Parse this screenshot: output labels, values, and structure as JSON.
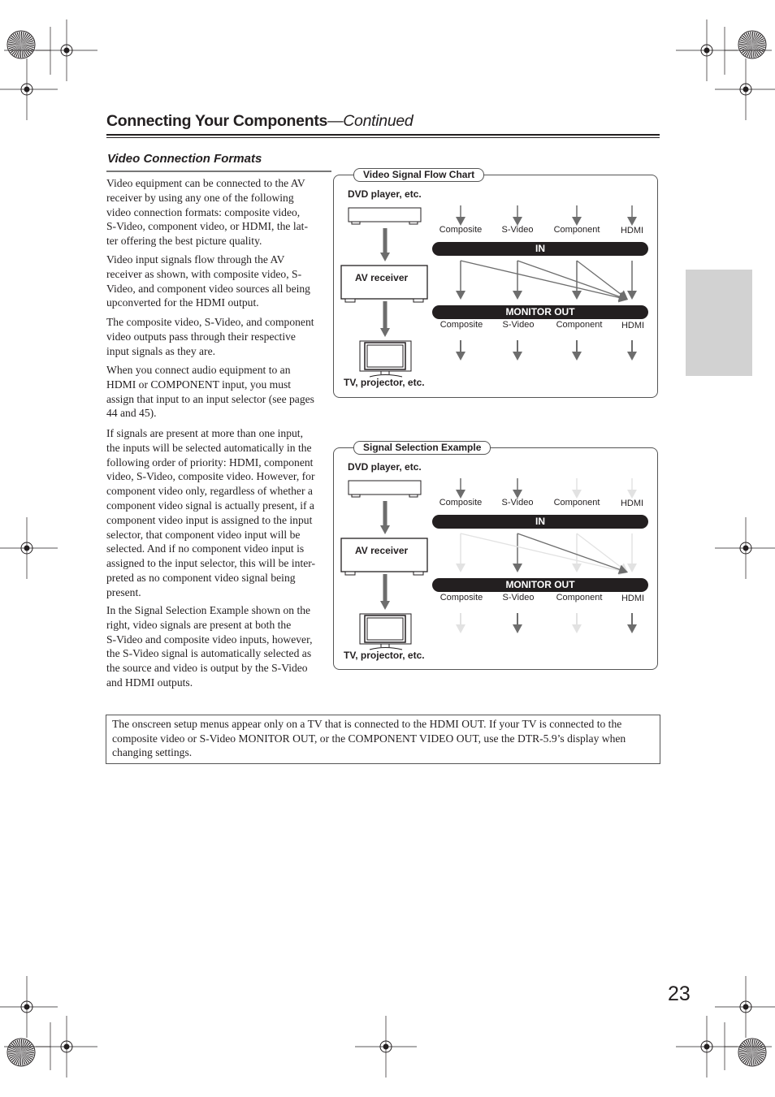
{
  "header": {
    "title": "Connecting Your Components",
    "continued": "—Continued"
  },
  "section": {
    "title": "Video Connection Formats"
  },
  "paragraphs": [
    [
      "Video equipment can be connected to the AV",
      "receiver by using any one of the following",
      "video connection formats: composite video,",
      "S-Video, component video, or HDMI, the lat-",
      "ter offering the best picture quality."
    ],
    [
      "Video input signals flow through the AV",
      "receiver as shown, with composite video, S-",
      "Video, and component video sources all being",
      "upconverted for the HDMI output."
    ],
    [
      "The composite video, S-Video, and component",
      "video outputs pass through their respective",
      "input signals as they are."
    ],
    [
      "When you connect audio equipment to an",
      "HDMI or COMPONENT input, you must",
      "assign that input to an input selector (see pages",
      "44 and 45)."
    ],
    [
      "If signals are present at more than one input,",
      "the inputs will be selected automatically in the",
      "following order of priority: HDMI, component",
      "video, S-Video, composite video. However, for",
      "component video only, regardless of whether a",
      "component video signal is actually present, if a",
      "component video input is assigned to the input",
      "selector, that component video input will be",
      "selected. And if no component video input is",
      "assigned to the input selector, this will be inter-",
      "preted as no component video signal being",
      "present."
    ],
    [
      "In the Signal Selection Example shown on the",
      "right, video signals are present at both the",
      "S-Video and composite video inputs, however,",
      "the S-Video signal is automatically selected as",
      "the source and video is output by the S-Video",
      "and HDMI outputs."
    ]
  ],
  "diagrams": [
    {
      "title": "Video Signal Flow Chart",
      "source_label": "DVD player, etc.",
      "receiver_label": "AV receiver",
      "display_label": "TV, projector, etc.",
      "in_label": "IN",
      "out_label": "MONITOR OUT",
      "inputs": [
        "Composite",
        "S-Video",
        "Component",
        "HDMI"
      ],
      "outputs": [
        "Composite",
        "S-Video",
        "Component",
        "HDMI"
      ],
      "input_active": [
        true,
        true,
        true,
        true
      ],
      "passthrough_active": [
        true,
        true,
        true,
        true
      ],
      "upconvert_active": [
        true,
        true,
        true
      ],
      "output_active": [
        true,
        true,
        true,
        true
      ]
    },
    {
      "title": "Signal Selection Example",
      "source_label": "DVD player, etc.",
      "receiver_label": "AV receiver",
      "display_label": "TV, projector, etc.",
      "in_label": "IN",
      "out_label": "MONITOR OUT",
      "inputs": [
        "Composite",
        "S-Video",
        "Component",
        "HDMI"
      ],
      "outputs": [
        "Composite",
        "S-Video",
        "Component",
        "HDMI"
      ],
      "input_active": [
        true,
        true,
        false,
        false
      ],
      "passthrough_active": [
        false,
        true,
        false,
        false
      ],
      "upconvert_active": [
        false,
        true,
        false
      ],
      "output_active": [
        false,
        true,
        false,
        true
      ]
    }
  ],
  "colors": {
    "active_arrow": "#6d6d6d",
    "inactive_arrow": "#e2e2e2",
    "bar": "#231f20",
    "side_tab": "#d2d2d2"
  },
  "note": "The onscreen setup menus appear only on a TV that is connected to the HDMI OUT. If your TV is connected to the composite video or S-Video MONITOR OUT, or the COMPONENT VIDEO OUT, use the DTR-5.9’s display when changing settings.",
  "page_number": "23"
}
